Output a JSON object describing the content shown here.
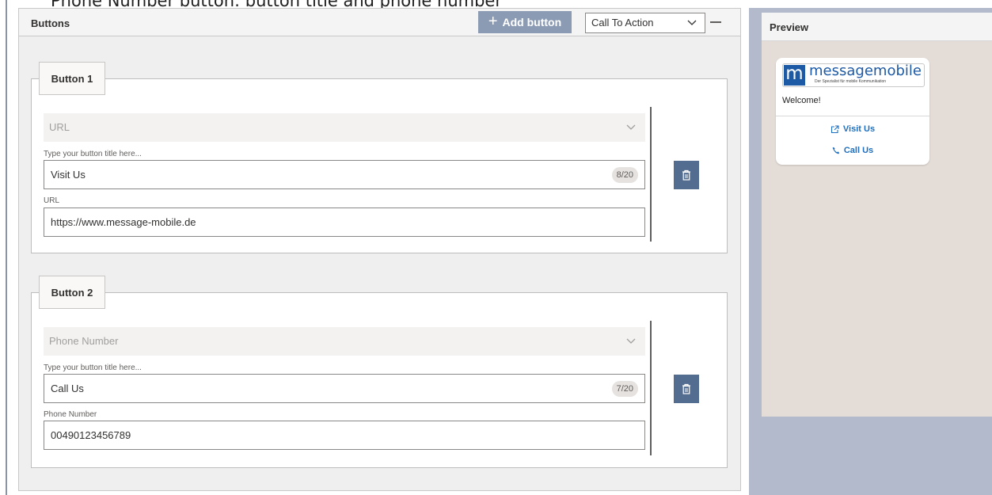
{
  "caption": "Phone Number button: button title and phone number",
  "buttons_panel": {
    "title": "Buttons",
    "add_button_label": "Add button",
    "action_type_select": "Call To Action"
  },
  "buttons": [
    {
      "legend": "Button 1",
      "type": "URL",
      "title_label": "Type your button title here...",
      "title_value": "Visit Us",
      "counter": "8/20",
      "value_label": "URL",
      "value": "https://www.message-mobile.de"
    },
    {
      "legend": "Button 2",
      "type": "Phone Number",
      "title_label": "Type your button title here...",
      "title_value": "Call Us",
      "counter": "7/20",
      "value_label": "Phone Number",
      "value": "00490123456789"
    }
  ],
  "preview": {
    "title": "Preview",
    "logo_word_1": "message",
    "logo_word_2": "mobile",
    "logo_letter": "m",
    "logo_tagline": "Der Spezialist für mobile Kommunikation",
    "message": "Welcome!",
    "actions": [
      {
        "label": "Visit Us",
        "icon": "external-link-icon"
      },
      {
        "label": "Call Us",
        "icon": "phone-icon"
      }
    ]
  },
  "colors": {
    "accent": "#536d91",
    "add_button": "#8b9bb4",
    "link": "#1f6fbf",
    "logo_blue": "#1d5aa6"
  }
}
